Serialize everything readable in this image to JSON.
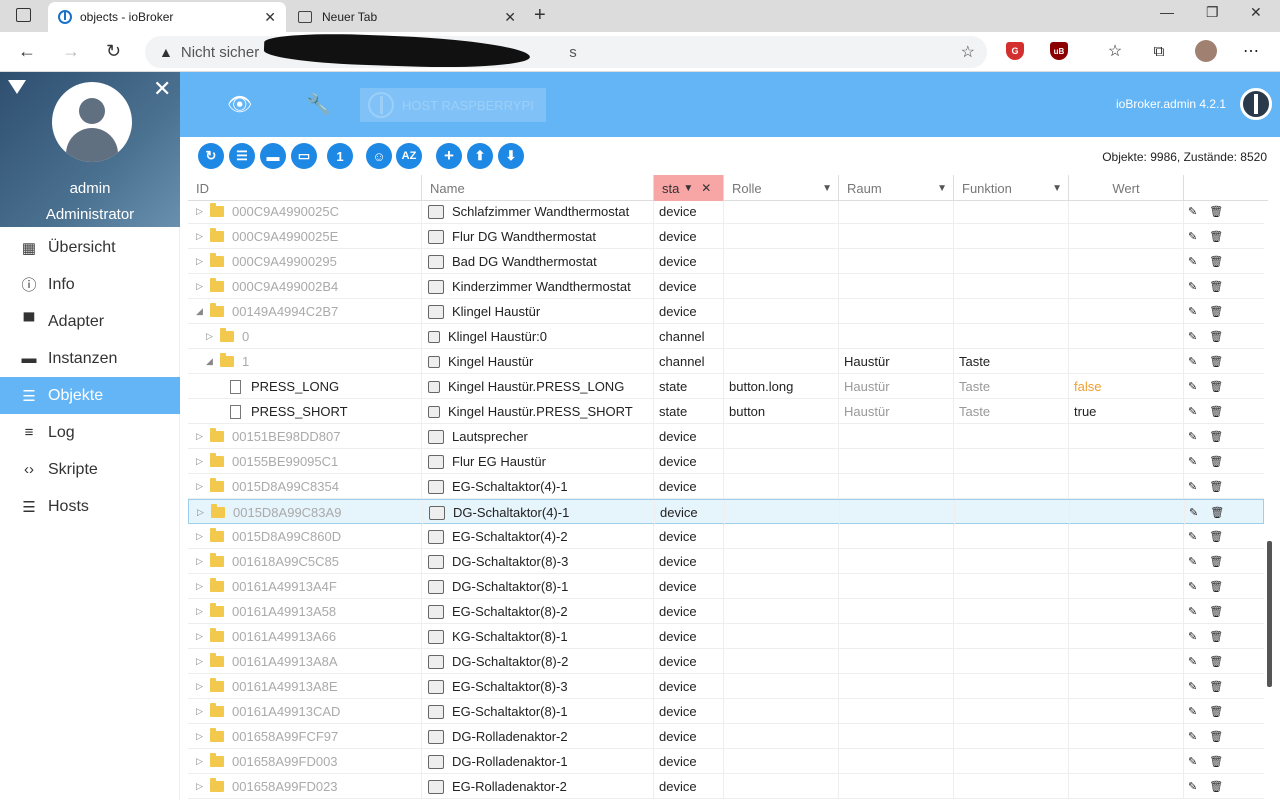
{
  "browser": {
    "tabs": [
      {
        "title": "objects - ioBroker"
      },
      {
        "title": "Neuer Tab"
      }
    ],
    "address_prefix": "Nicht sicher",
    "address_suffix": "s"
  },
  "user": {
    "name": "admin",
    "role": "Administrator"
  },
  "menu": [
    {
      "label": "Übersicht",
      "icon": "grid-icon"
    },
    {
      "label": "Info",
      "icon": "info-icon"
    },
    {
      "label": "Adapter",
      "icon": "store-icon"
    },
    {
      "label": "Instanzen",
      "icon": "instances-icon"
    },
    {
      "label": "Objekte",
      "icon": "list-icon",
      "active": true
    },
    {
      "label": "Log",
      "icon": "log-icon"
    },
    {
      "label": "Skripte",
      "icon": "code-icon"
    },
    {
      "label": "Hosts",
      "icon": "hosts-icon"
    }
  ],
  "header": {
    "host": "HOST RASPBERRYPI",
    "version": "ioBroker.admin 4.2.1"
  },
  "counts": "Objekte: 9986, Zustände: 8520",
  "columns": {
    "id": "ID",
    "name": "Name",
    "type": "sta",
    "role": "Rolle",
    "room": "Raum",
    "function": "Funktion",
    "value": "Wert"
  },
  "colors": {
    "accent": "#64b5f6",
    "button": "#1e88e5",
    "filter_highlight": "#f8a5a5",
    "false_value": "#f0a030"
  },
  "rows": [
    {
      "id": "000C9A4990025C",
      "name": "Schlafzimmer Wandthermostat",
      "type": "device",
      "role": "",
      "room": "",
      "func": "",
      "value": ""
    },
    {
      "id": "000C9A4990025E",
      "name": "Flur DG Wandthermostat",
      "type": "device",
      "role": "",
      "room": "",
      "func": "",
      "value": ""
    },
    {
      "id": "000C9A49900295",
      "name": "Bad DG Wandthermostat",
      "type": "device",
      "role": "",
      "room": "",
      "func": "",
      "value": ""
    },
    {
      "id": "000C9A499002B4",
      "name": "Kinderzimmer Wandthermostat",
      "type": "device",
      "role": "",
      "room": "",
      "func": "",
      "value": ""
    },
    {
      "id": "00149A4994C2B7",
      "name": "Klingel Haustür",
      "type": "device",
      "role": "",
      "room": "",
      "func": "",
      "value": ""
    },
    {
      "id": "0",
      "name": "Klingel Haustür:0",
      "type": "channel",
      "role": "",
      "room": "",
      "func": "",
      "value": ""
    },
    {
      "id": "1",
      "name": "Kingel Haustür",
      "type": "channel",
      "role": "",
      "room": "Haustür",
      "func": "Taste",
      "value": ""
    },
    {
      "id": "PRESS_LONG",
      "name": "Kingel Haustür.PRESS_LONG",
      "type": "state",
      "role": "button.long",
      "room": "Haustür",
      "func": "Taste",
      "value": "false"
    },
    {
      "id": "PRESS_SHORT",
      "name": "Kingel Haustür.PRESS_SHORT",
      "type": "state",
      "role": "button",
      "room": "Haustür",
      "func": "Taste",
      "value": "true"
    },
    {
      "id": "00151BE98DD807",
      "name": "Lautsprecher",
      "type": "device",
      "role": "",
      "room": "",
      "func": "",
      "value": ""
    },
    {
      "id": "00155BE99095C1",
      "name": "Flur EG Haustür",
      "type": "device",
      "role": "",
      "room": "",
      "func": "",
      "value": ""
    },
    {
      "id": "0015D8A99C8354",
      "name": "EG-Schaltaktor(4)-1",
      "type": "device",
      "role": "",
      "room": "",
      "func": "",
      "value": ""
    },
    {
      "id": "0015D8A99C83A9",
      "name": "DG-Schaltaktor(4)-1",
      "type": "device",
      "role": "",
      "room": "",
      "func": "",
      "value": ""
    },
    {
      "id": "0015D8A99C860D",
      "name": "EG-Schaltaktor(4)-2",
      "type": "device",
      "role": "",
      "room": "",
      "func": "",
      "value": ""
    },
    {
      "id": "001618A99C5C85",
      "name": "DG-Schaltaktor(8)-3",
      "type": "device",
      "role": "",
      "room": "",
      "func": "",
      "value": ""
    },
    {
      "id": "00161A49913A4F",
      "name": "DG-Schaltaktor(8)-1",
      "type": "device",
      "role": "",
      "room": "",
      "func": "",
      "value": ""
    },
    {
      "id": "00161A49913A58",
      "name": "EG-Schaltaktor(8)-2",
      "type": "device",
      "role": "",
      "room": "",
      "func": "",
      "value": ""
    },
    {
      "id": "00161A49913A66",
      "name": "KG-Schaltaktor(8)-1",
      "type": "device",
      "role": "",
      "room": "",
      "func": "",
      "value": ""
    },
    {
      "id": "00161A49913A8A",
      "name": "DG-Schaltaktor(8)-2",
      "type": "device",
      "role": "",
      "room": "",
      "func": "",
      "value": ""
    },
    {
      "id": "00161A49913A8E",
      "name": "EG-Schaltaktor(8)-3",
      "type": "device",
      "role": "",
      "room": "",
      "func": "",
      "value": ""
    },
    {
      "id": "00161A49913CAD",
      "name": "EG-Schaltaktor(8)-1",
      "type": "device",
      "role": "",
      "room": "",
      "func": "",
      "value": ""
    },
    {
      "id": "001658A99FCF97",
      "name": "DG-Rolladenaktor-2",
      "type": "device",
      "role": "",
      "room": "",
      "func": "",
      "value": ""
    },
    {
      "id": "001658A99FD003",
      "name": "DG-Rolladenaktor-1",
      "type": "device",
      "role": "",
      "room": "",
      "func": "",
      "value": ""
    },
    {
      "id": "001658A99FD023",
      "name": "EG-Rolladenaktor-2",
      "type": "device",
      "role": "",
      "room": "",
      "func": "",
      "value": ""
    }
  ]
}
